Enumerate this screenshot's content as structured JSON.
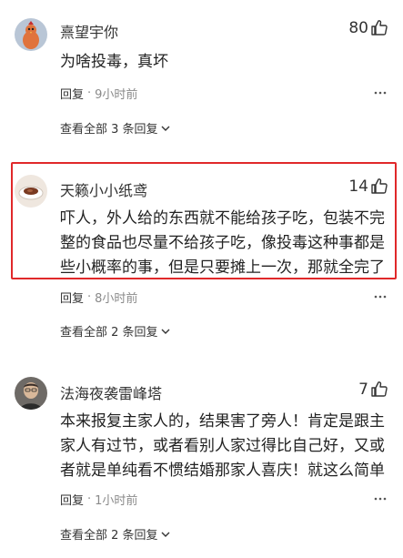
{
  "comments": [
    {
      "username": "熹望宇你",
      "likes": "80",
      "text": "为啥投毒，真坏",
      "reply_label": "回复",
      "separator": "·",
      "time": "9小时前",
      "view_replies": "查看全部 3 条回复",
      "avatar_icon": "chicken-avatar"
    },
    {
      "username": "天籁小小纸鸢",
      "likes": "14",
      "text": "吓人，外人给的东西就不能给孩子吃，包装不完整的食品也尽量不给孩子吃，像投毒这种事都是些小概率的事，但是只要摊上一次，那就全完了",
      "reply_label": "回复",
      "separator": "·",
      "time": "8小时前",
      "view_replies": "查看全部 2 条回复",
      "avatar_icon": "coffee-cup-avatar"
    },
    {
      "username": "法海夜袭雷峰塔",
      "likes": "7",
      "text": "本来报复主家人的，结果害了旁人！肯定是跟主家人有过节，或者看别人家过得比自己好，又或者就是单纯看不惯结婚那家人喜庆！就这么简单",
      "reply_label": "回复",
      "separator": "·",
      "time": "1小时前",
      "view_replies": "查看全部 2 条回复",
      "avatar_icon": "man-portrait-avatar"
    }
  ],
  "colors": {
    "highlight_border": "#e0282a",
    "meta_grey": "#8a8a8a",
    "text": "#222222"
  }
}
